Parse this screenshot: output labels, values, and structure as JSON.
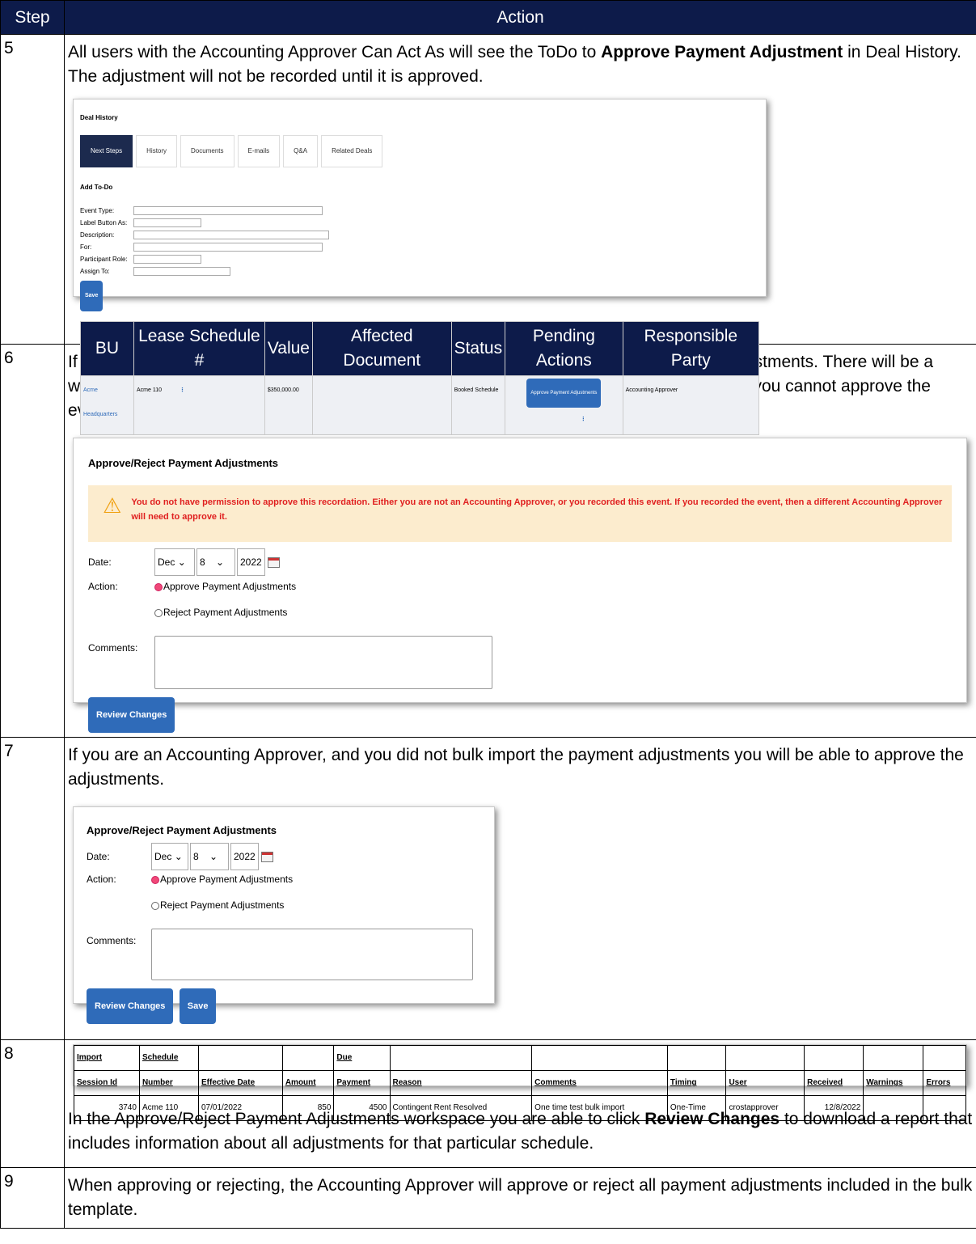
{
  "header": {
    "step": "Step",
    "action": "Action"
  },
  "steps": [
    {
      "num": "5",
      "text_before": "All users with the Accounting Approver Can Act As will see the ToDo to ",
      "text_bold": "Approve Payment Adjustment",
      "text_after": " in Deal History. The adjustment will not be recorded until it is approved."
    },
    {
      "num": "6",
      "text": "If you were the user that bulk imported the PIW, you will not be allowed to approve any adjustments. There will be a warning message in the Approve/Reject Payment Adjustments workspace letting you know you cannot approve the event."
    },
    {
      "num": "7",
      "text": "If you are an Accounting Approver, and you did not bulk import the payment adjustments you will be able to approve the adjustments."
    },
    {
      "num": "8",
      "text_before": "In the Approve/Reject Payment Adjustments workspace you are able to click ",
      "text_bold": "Review Changes",
      "text_after": " to download a report that includes information about all adjustments for that particular schedule."
    },
    {
      "num": "9",
      "text": "When approving or rejecting, the Accounting Approver will approve or reject all payment adjustments included in the bulk template."
    }
  ],
  "deal_history": {
    "title": "Deal History",
    "tabs": [
      "Next Steps",
      "History",
      "Documents",
      "E-mails",
      "Q&A",
      "Related Deals"
    ],
    "add_todo": "Add To-Do",
    "fields": [
      "Event Type:",
      "Label Button As:",
      "Description:",
      "For:",
      "Participant Role:",
      "Assign To:"
    ],
    "save": "Save",
    "columns": [
      "BU",
      "Lease Schedule #",
      "Value",
      "Affected Document",
      "Status",
      "Pending Actions",
      "Responsible Party"
    ],
    "row": {
      "bu": "Acme Headquarters",
      "lease": "Acme 110",
      "value": "$350,000.00",
      "doc": "",
      "status": "Booked Schedule",
      "pending": "Approve Payment Adjustments",
      "party": "Accounting Approver"
    }
  },
  "approve_form": {
    "title": "Approve/Reject Payment Adjustments",
    "warning": "You do not have permission to approve this recordation. Either you are not an Accounting Approver, or you recorded this event. If you recorded the event, then a different Accounting Approver will need to approve it.",
    "date_label": "Date:",
    "month": "Dec",
    "day": "8",
    "year": "2022",
    "action_label": "Action:",
    "opt_approve": "Approve Payment Adjustments",
    "opt_reject": "Reject Payment Adjustments",
    "comments_label": "Comments:",
    "review": "Review Changes",
    "save": "Save"
  },
  "report": {
    "headers": [
      [
        "Import",
        "Session Id"
      ],
      [
        "Schedule",
        "Number"
      ],
      [
        "",
        "Effective Date"
      ],
      [
        "",
        "Amount"
      ],
      [
        "Due",
        "Payment"
      ],
      [
        "",
        "Reason"
      ],
      [
        "",
        "Comments"
      ],
      [
        "",
        "Timing"
      ],
      [
        "",
        "User"
      ],
      [
        "",
        "Received"
      ],
      [
        "",
        "Warnings"
      ],
      [
        "",
        "Errors"
      ]
    ],
    "row": [
      "3740",
      "Acme 110",
      "07/01/2022",
      "850",
      "4500",
      "Contingent Rent Resolved",
      "One time test bulk import",
      "One-Time",
      "crostapprover",
      "12/8/2022",
      "",
      ""
    ]
  }
}
